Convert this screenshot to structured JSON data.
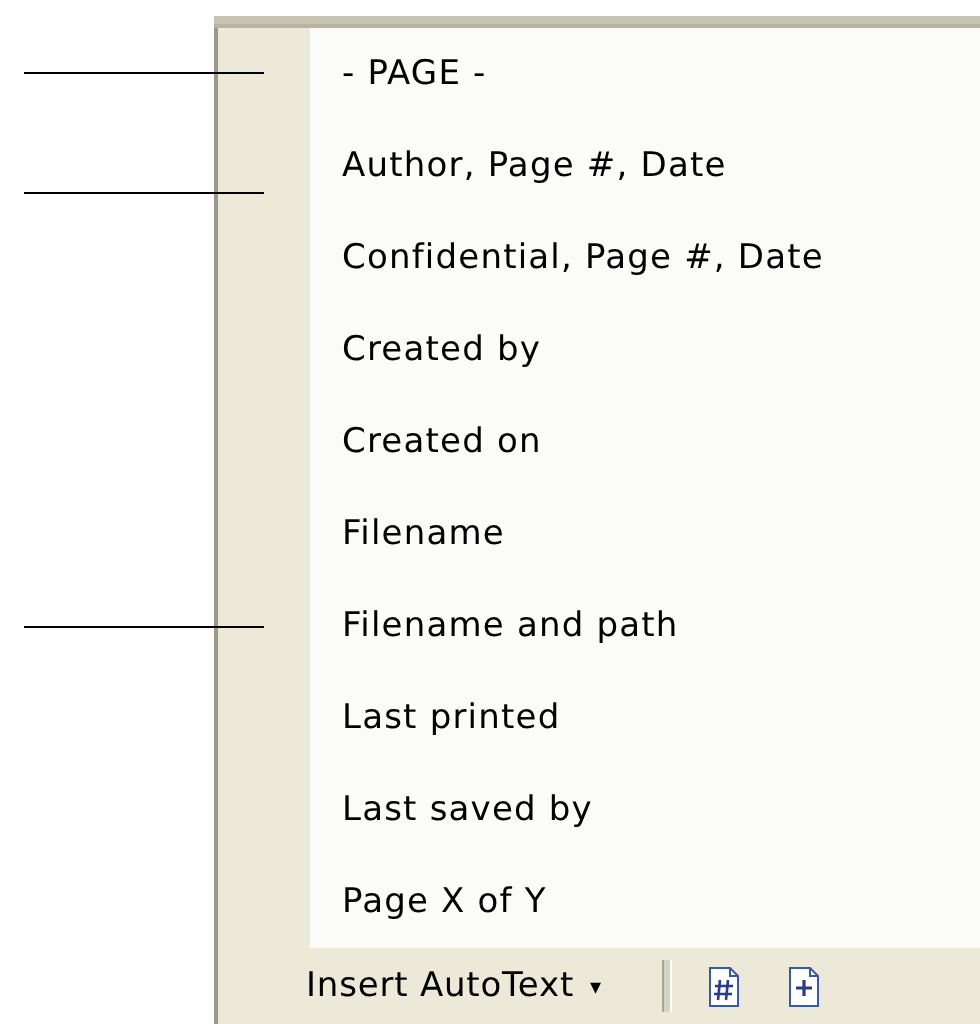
{
  "menu": {
    "items": [
      {
        "label": "- PAGE -",
        "marked": true
      },
      {
        "label": "Author, Page #, Date",
        "marked": true
      },
      {
        "label": "Confidential, Page #, Date",
        "marked": false
      },
      {
        "label": "Created by",
        "marked": false
      },
      {
        "label": "Created on",
        "marked": false
      },
      {
        "label": "Filename",
        "marked": false
      },
      {
        "label": "Filename and path",
        "marked": true
      },
      {
        "label": "Last printed",
        "marked": false
      },
      {
        "label": "Last saved by",
        "marked": false
      },
      {
        "label": "Page X of Y",
        "marked": false
      }
    ]
  },
  "toolbar": {
    "autotext_button": {
      "label": "Insert AutoText",
      "caret": "▾"
    },
    "buttons": [
      {
        "kind": "page-number"
      },
      {
        "kind": "page-count"
      }
    ]
  }
}
